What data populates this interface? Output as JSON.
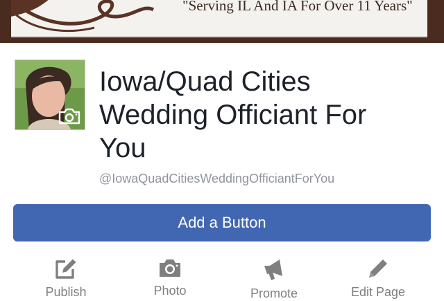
{
  "cover": {
    "tagline": "\"Serving IL And IA For Over 11 Years\""
  },
  "profile": {
    "name": "Iowa/Quad Cities Wedding Officiant For You",
    "handle": "@IowaQuadCitiesWeddingOfficiantForYou"
  },
  "primary_action": {
    "label": "Add a Button",
    "color": "#4267b2"
  },
  "actions": [
    {
      "label": "Publish",
      "icon": "compose-icon"
    },
    {
      "label": "Photo",
      "icon": "camera-icon"
    },
    {
      "label": "Promote",
      "icon": "megaphone-icon"
    },
    {
      "label": "Edit Page",
      "icon": "pencil-icon"
    }
  ]
}
